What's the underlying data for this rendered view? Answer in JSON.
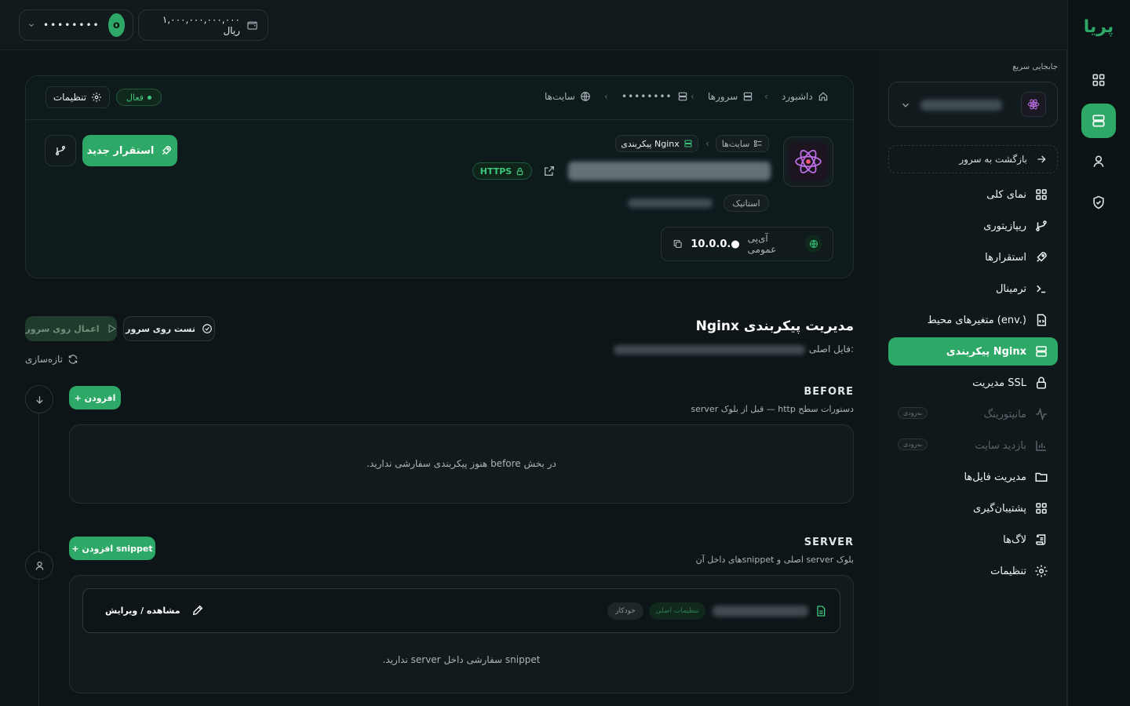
{
  "header": {
    "user_masked": "••••••••",
    "user_initial": "o",
    "balance": "۱,۰۰۰,۰۰۰,۰۰۰,۰۰۰ ریال"
  },
  "logo": {
    "text": "پریا"
  },
  "sidebar": {
    "quick_switch_label": "جابجایی سریع",
    "back_label": "بازگشت به سرور",
    "items": [
      {
        "label": "نمای کلی",
        "icon": "grid-icon"
      },
      {
        "label": "ریپازیتوری",
        "icon": "git-branch-icon"
      },
      {
        "label": "استقرارها",
        "icon": "rocket-icon"
      },
      {
        "label": "ترمینال",
        "icon": "terminal-icon"
      },
      {
        "label": "متغیرهای محیط (env.)",
        "icon": "env-file-icon"
      },
      {
        "label": "پیکربندی Nginx",
        "icon": "server-icon",
        "active": true
      },
      {
        "label": "مدیریت SSL",
        "icon": "lock-icon"
      },
      {
        "label": "مانیتورینگ",
        "icon": "activity-icon",
        "soon": "به‌زودی"
      },
      {
        "label": "بازدید سایت",
        "icon": "bar-chart-icon",
        "soon": "به‌زودی"
      },
      {
        "label": "مدیریت فایل‌ها",
        "icon": "folder-icon"
      },
      {
        "label": "پشتیبان‌گیری",
        "icon": "backup-grid-icon"
      },
      {
        "label": "لاگ‌ها",
        "icon": "scroll-icon"
      },
      {
        "label": "تنظیمات",
        "icon": "gear-icon"
      }
    ]
  },
  "breadcrumb": {
    "dashboard": "داشبورد",
    "servers": "سرورها",
    "server_masked": "••••••••",
    "sites": "سایت‌ها"
  },
  "site_card": {
    "status": "فعال",
    "settings_label": "تنظیمات",
    "deploy_label": "استقرار جدید",
    "tag_sites": "سایت‌ها",
    "tag_nginx": "پیکربندی Nginx",
    "https_label": "HTTPS",
    "type_tag": "استاتیک",
    "ip_label": "آی‌پی عمومی",
    "ip_value": "10.0.0.●"
  },
  "nginx": {
    "title": "مدیریت پیکربندی Nginx",
    "main_file_label": "فایل اصلی:",
    "test_label": "تست روی سرور",
    "apply_label": "اعمال روی سرور",
    "refresh_label": "تازه‌سازی",
    "before": {
      "title": "BEFORE",
      "subtitle": "دستورات سطح http — قبل از بلوک server",
      "add_label": "+ افزودن",
      "empty_text": "در بخش before هنوز پیکربندی سفارشی ندارید."
    },
    "server": {
      "title": "SERVER",
      "subtitle": "بلوک server اصلی و snippetهای داخل آن",
      "add_label": "+ افزودن snippet",
      "view_edit_label": "مشاهده / ویرایش",
      "auto_tag": "خودکار",
      "main_settings_tag": "تنظیمات اصلی",
      "empty_text": "snippet سفارشی داخل server ندارید."
    }
  },
  "colors": {
    "accent": "#2ea866",
    "background": "#0e1518"
  }
}
